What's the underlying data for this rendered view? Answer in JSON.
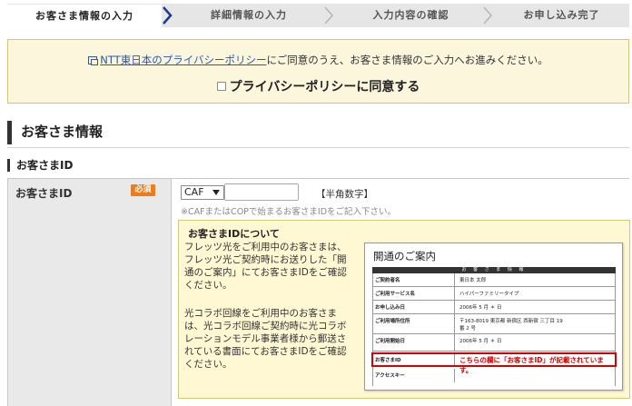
{
  "steps": [
    {
      "label": "お客さま情報の入力"
    },
    {
      "label": "詳細情報の入力"
    },
    {
      "label": "入力内容の確認"
    },
    {
      "label": "お申し込み完了"
    }
  ],
  "privacy": {
    "link_text": "NTT東日本のプライバシーポリシー",
    "line1_rest": "にご同意のうえ、お客さま情報のご入力へお進みください。",
    "checkbox_label": "プライバシーポリシーに同意する"
  },
  "section": {
    "title": "お客さま情報",
    "subtitle": "お客さまID"
  },
  "field": {
    "label": "お客さまID",
    "required_badge": "必須",
    "select_value": "CAF",
    "input_value": "",
    "hankaku": "【半角数字】",
    "note": "※CAFまたはCOPで始まるお客さまIDをご記入下さい。"
  },
  "info": {
    "title": "お客さまIDについて",
    "para1": "フレッツ光をご利用中のお客さまは、フレッツ光ご契約時にお送りした「開通のご案内」にてお客さまIDをご確認ください。",
    "para2": "光コラボ回線をご利用中のお客さまは、光コラボ回線ご契約時に光コラボレーションモデル事業者様から郵送されている書面にてお客さまIDをご確認ください。"
  },
  "document": {
    "title": "開通のご案内",
    "header": "お 客 さ ま 情 報",
    "rows": [
      {
        "k": "ご契約者名",
        "v": "東日本 太郎"
      },
      {
        "k": "ご利用サービス名",
        "v": "ハイパーファミリータイプ"
      },
      {
        "k": "お申し込み日",
        "v": "2006年 5 月 ＊ 日"
      },
      {
        "k": "ご利用場所住所",
        "v": "〒163-8019 東京都 新宿区 西新宿 三丁目 19 番 2 号"
      },
      {
        "k": "ご利用開始日",
        "v": "2006年 5 月 ＊ 日"
      },
      {
        "k": "お客さまID",
        "v": "こちらの欄に「お客さまID」が記載されています。"
      },
      {
        "k": "アクセスキー",
        "v": ""
      }
    ]
  },
  "colors": {
    "required_badge": "#ee7b1e",
    "link": "#2a57b0",
    "privacy_bg": "#fcf6dd",
    "info_bg": "#fff8d2",
    "highlight_red": "#d40000"
  }
}
